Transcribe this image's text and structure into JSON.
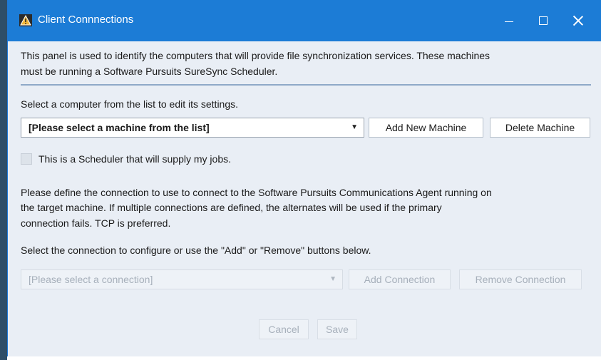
{
  "window": {
    "title": "Client Connnections",
    "controls": {
      "minimize": "minimize",
      "maximize": "maximize",
      "close": "close"
    }
  },
  "intro": {
    "line1": "This panel is used to identify the computers that will provide file synchronization services. These machines",
    "line2": "must be running a Software Pursuits SureSync Scheduler."
  },
  "machine": {
    "prompt": "Select a computer from the list to edit its settings.",
    "selected": "[Please select a machine from the list]",
    "add_button": "Add New Machine",
    "delete_button": "Delete Machine",
    "scheduler_checkbox_label": "This is a Scheduler that will supply my jobs.",
    "scheduler_checked": false
  },
  "connection": {
    "desc_line1": "Please define the connection to use to connect to the Software Pursuits Communications Agent running on",
    "desc_line2": "the target machine. If multiple connections are defined, the alternates will be used if the primary",
    "desc_line3": "connection fails. TCP is preferred.",
    "prompt": "Select the connection to configure or use the \"Add\" or \"Remove\" buttons below.",
    "selected": "[Please select a connection]",
    "add_button": "Add Connection",
    "remove_button": "Remove Connection"
  },
  "footer": {
    "cancel_button": "Cancel",
    "save_button": "Save"
  },
  "colors": {
    "titlebar": "#1c7cd6",
    "client_bg": "#e9eef5",
    "divider": "#8fa9c8",
    "disabled_text": "#a7b0bb"
  }
}
